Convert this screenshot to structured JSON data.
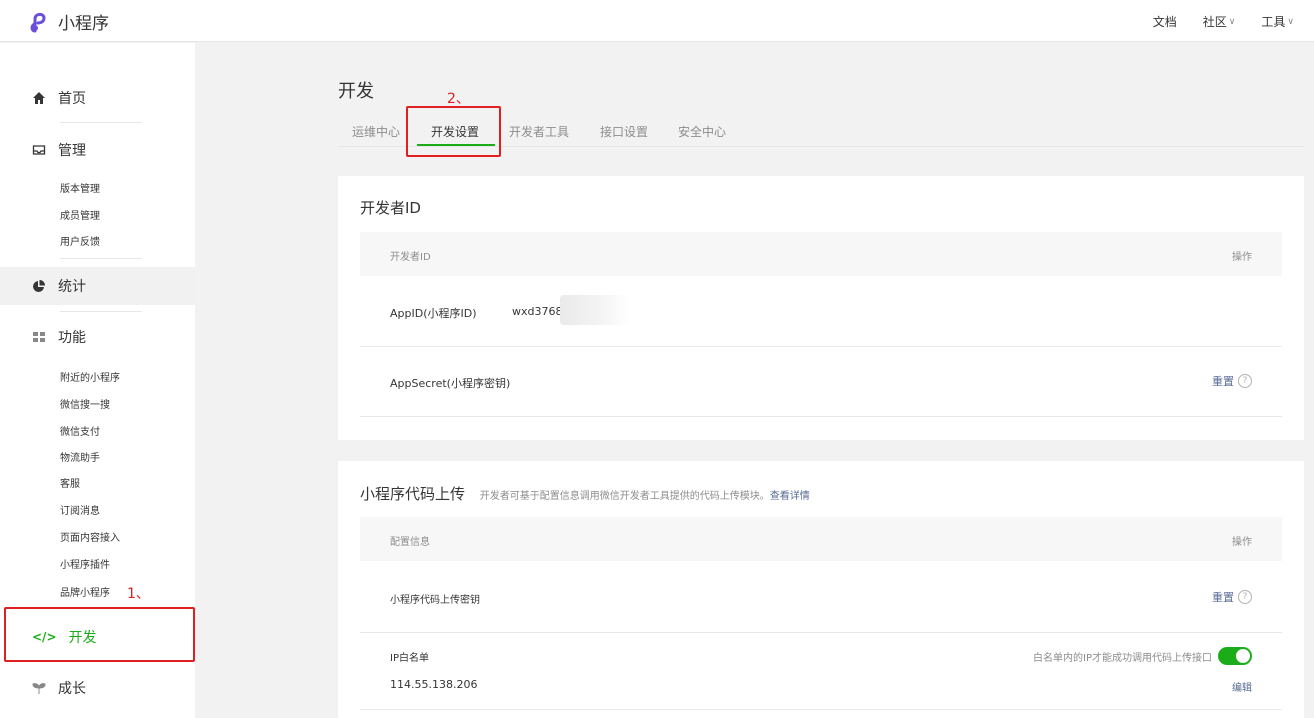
{
  "header": {
    "app_name": "小程序",
    "nav": [
      {
        "label": "文档",
        "has_caret": false
      },
      {
        "label": "社区",
        "has_caret": true
      },
      {
        "label": "工具",
        "has_caret": true
      }
    ]
  },
  "sidebar": {
    "home": "首页",
    "manage": "管理",
    "manage_items": [
      "版本管理",
      "成员管理",
      "用户反馈"
    ],
    "stats": "统计",
    "features": "功能",
    "feature_items": [
      "附近的小程序",
      "微信搜一搜",
      "微信支付",
      "物流助手",
      "客服",
      "订阅消息",
      "页面内容接入",
      "小程序插件",
      "品牌小程序"
    ],
    "develop": "开发",
    "growth": "成长",
    "annotation": "1、"
  },
  "main": {
    "title": "开发",
    "tabs": [
      "运维中心",
      "开发设置",
      "开发者工具",
      "接口设置",
      "安全中心"
    ],
    "active_tab": "开发设置",
    "tab_annotation": "2、"
  },
  "developer_id": {
    "title": "开发者ID",
    "col_left": "开发者ID",
    "col_right": "操作",
    "appid_label": "AppID(小程序ID)",
    "appid_value": "wxd3768",
    "secret_label": "AppSecret(小程序密钥)",
    "reset": "重置"
  },
  "upload": {
    "title": "小程序代码上传",
    "desc": "开发者可基于配置信息调用微信开发者工具提供的代码上传模块。",
    "desc_link": "查看详情",
    "col_left": "配置信息",
    "col_right": "操作",
    "key_label": "小程序代码上传密钥",
    "reset": "重置",
    "ip_label": "IP白名单",
    "ip_value": "114.55.138.206",
    "ip_hint": "白名单内的IP才能成功调用代码上传接口",
    "ip_toggle_on": true,
    "edit": "编辑"
  },
  "colors": {
    "accent_green": "#1aad19",
    "link_blue": "#576b95",
    "annotation_red": "#e02020"
  }
}
